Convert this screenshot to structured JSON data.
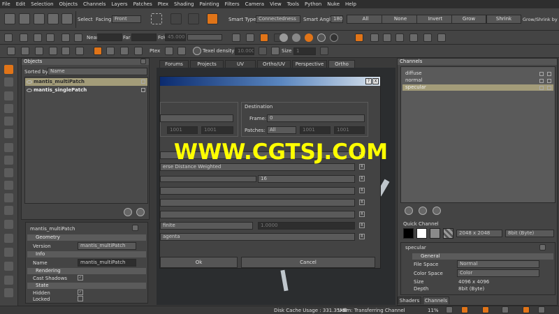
{
  "menu": [
    "File",
    "Edit",
    "Selection",
    "Objects",
    "Channels",
    "Layers",
    "Patches",
    "Ptex",
    "Shading",
    "Painting",
    "Filters",
    "Camera",
    "View",
    "Tools",
    "Python",
    "Nuke",
    "Help"
  ],
  "toolbar1": {
    "select_label": "Select",
    "facing_label": "Facing",
    "facing_value": "Front",
    "smart_type_label": "Smart Type:",
    "smart_type_value": "Connectedness",
    "smart_angle_label": "Smart Angle",
    "smart_angle_value": "180",
    "all_label": "All",
    "none_label": "None",
    "invert_label": "Invert",
    "grow_label": "Grow",
    "shrink_label": "Shrink",
    "grow_shrink_label": "Grow/Shrink by"
  },
  "toolbar2": {
    "near_label": "Near",
    "far_label": "Far",
    "fov_label": "FoV",
    "fov_value": "45.000"
  },
  "toolbar3": {
    "ptex_label": "Ptex",
    "texel_label": "Texel density :",
    "texel_value": "10.000",
    "size_label": "Size :",
    "size_value": "1"
  },
  "objects_panel": {
    "title": "Objects",
    "sorted_by_label": "Sorted by",
    "sorted_by_value": "Name",
    "items": [
      "mantis_multiPatch",
      "mantis_singlePatch"
    ]
  },
  "props_panel": {
    "object_name": "mantis_multiPatch",
    "geometry_section": "Geometry",
    "version_label": "Version",
    "version_value": "mantis_multiPatch",
    "info_section": "Info",
    "name_label": "Name",
    "name_value": "mantis_multiPatch",
    "rendering_section": "Rendering",
    "cast_shadows_label": "Cast Shadows",
    "state_section": "State",
    "hidden_label": "Hidden",
    "locked_label": "Locked"
  },
  "view_tabs": [
    "Forums",
    "Projects",
    "UV",
    "Ortho/UV",
    "Perspective",
    "Ortho"
  ],
  "dialog": {
    "destination_label": "Destination",
    "frame_label": "Frame:",
    "frame_value": "0",
    "patches_label": "Patches:",
    "patches_value": "All",
    "left_field_1": "1001",
    "left_field_2": "1001",
    "dest_field_1": "1001",
    "dest_field_2": "1001",
    "weight_label": "erse Distance Weighted",
    "slider_value": "16",
    "finite_label": "finite",
    "finite_value": "1.0000",
    "agenta_label": "agenta",
    "ok_label": "Ok",
    "cancel_label": "Cancel",
    "help_btn": "?",
    "close_btn": "X"
  },
  "watermark": "WWW.CGTSJ.COM",
  "channels_panel": {
    "title": "Channels",
    "items": [
      "diffuse",
      "normal",
      "specular"
    ],
    "quick_channel_label": "Quick Channel",
    "resolution_value": "2048 x 2048",
    "depth_value": "8bit (Byte)",
    "selected_channel": "specular",
    "general_section": "General",
    "file_space_label": "File Space",
    "file_space_value": "Normal",
    "color_space_label": "Color Space",
    "color_space_value": "Color",
    "size_label": "Size",
    "size_value": "4096 x 4096",
    "depth_label": "Depth",
    "depth_info_value": "8bit (Byte)",
    "bottom_tabs": [
      "Shaders",
      "Channels"
    ]
  },
  "status": {
    "disk_cache": "Disk Cache Usage : 331.35MB",
    "udim": "Udim: Transferring Channel",
    "percent": "11%"
  },
  "colors": {
    "accent_orange": "#e07418",
    "selection": "#a39c79",
    "watermark": "#ffff00"
  }
}
